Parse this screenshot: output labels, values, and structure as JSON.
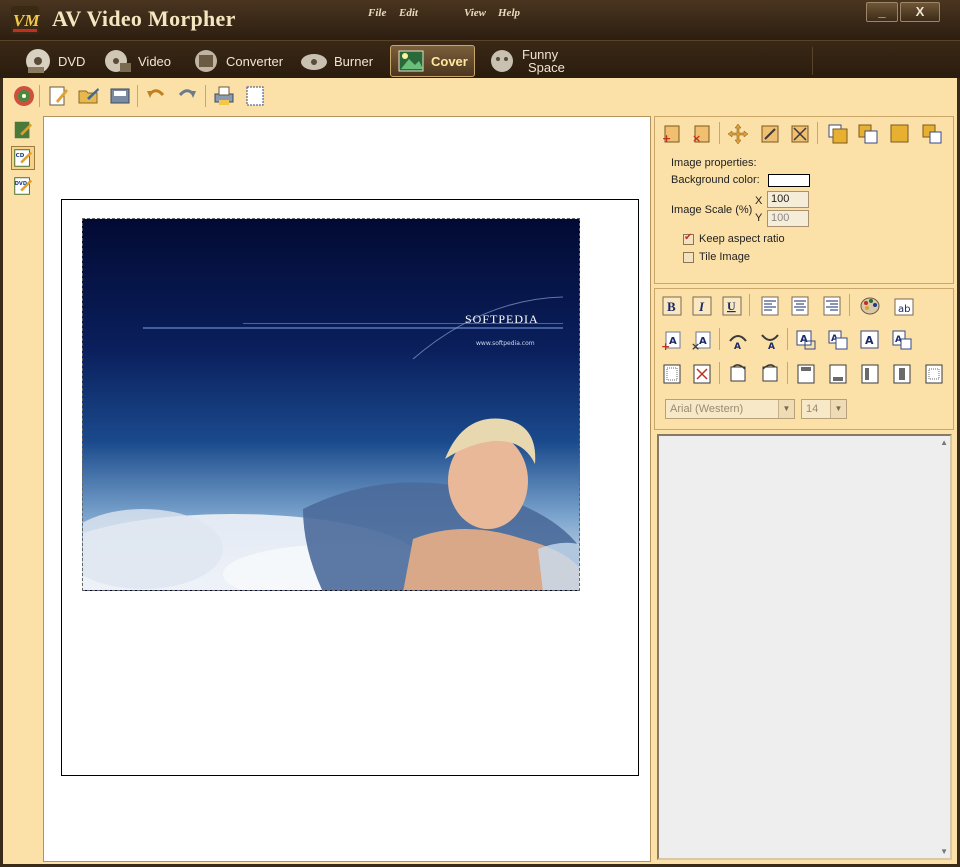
{
  "app": {
    "title": "AV Video Morpher",
    "logo_text": "VM"
  },
  "menu": {
    "file": "File",
    "edit": "Edit",
    "view": "View",
    "help": "Help"
  },
  "window": {
    "minimize": "_",
    "close": "X"
  },
  "tabs": [
    {
      "label": "DVD",
      "icon": "dvd-disc-icon"
    },
    {
      "label": "Video",
      "icon": "video-reel-icon"
    },
    {
      "label": "Converter",
      "icon": "converter-icon"
    },
    {
      "label": "Burner",
      "icon": "burner-icon"
    },
    {
      "label": "Cover",
      "icon": "cover-icon",
      "active": true
    },
    {
      "label": "Funny",
      "label2": "Space",
      "icon": "funny-space-icon"
    }
  ],
  "cover_image": {
    "brand": "SOFTPEDIA",
    "url": "www.softpedia.com"
  },
  "properties": {
    "heading": "Image properties:",
    "background_color_label": "Background color:",
    "background_color": "#ffffff",
    "scale_label": "Image Scale (%)",
    "x_label": "X",
    "y_label": "Y",
    "scale_x": "100",
    "scale_y": "100",
    "keep_aspect_label": "Keep aspect ratio",
    "keep_aspect_checked": true,
    "tile_label": "Tile Image",
    "tile_checked": false
  },
  "font": {
    "family": "Arial (Western)",
    "size": "14"
  },
  "colors": {
    "accent": "#fbe0a8",
    "titlebar": "#2c1e10",
    "active_tab": "#ffe8a0"
  }
}
